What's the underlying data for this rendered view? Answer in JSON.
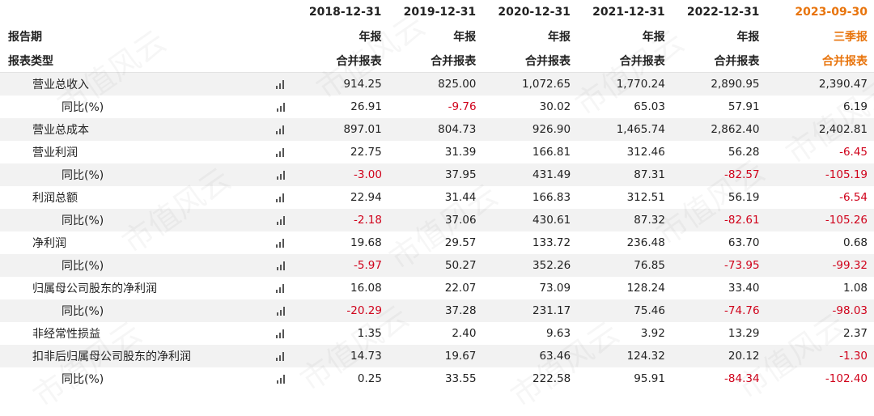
{
  "header": {
    "periods": [
      "2018-12-31",
      "2019-12-31",
      "2020-12-31",
      "2021-12-31",
      "2022-12-31",
      "2023-09-30"
    ],
    "report_period_label": "报告期",
    "report_types": [
      "年报",
      "年报",
      "年报",
      "年报",
      "年报",
      "三季报"
    ],
    "statement_type_label": "报表类型",
    "statement_types": [
      "合并报表",
      "合并报表",
      "合并报表",
      "合并报表",
      "合并报表",
      "合并报表"
    ]
  },
  "colors": {
    "negative": "#d0021b",
    "current_period": "#e8740c",
    "alt_row": "#f2f2f2"
  },
  "icons": {
    "chart": "bar-chart-icon"
  },
  "watermark": "市值风云",
  "rows": [
    {
      "label": "营业总收入",
      "level": 1,
      "values": [
        "914.25",
        "825.00",
        "1,072.65",
        "1,770.24",
        "2,890.95",
        "2,390.47"
      ]
    },
    {
      "label": "同比(%)",
      "level": 2,
      "values": [
        "26.91",
        "-9.76",
        "30.02",
        "65.03",
        "57.91",
        "6.19"
      ]
    },
    {
      "label": "营业总成本",
      "level": 1,
      "values": [
        "897.01",
        "804.73",
        "926.90",
        "1,465.74",
        "2,862.40",
        "2,402.81"
      ]
    },
    {
      "label": "营业利润",
      "level": 1,
      "values": [
        "22.75",
        "31.39",
        "166.81",
        "312.46",
        "56.28",
        "-6.45"
      ]
    },
    {
      "label": "同比(%)",
      "level": 2,
      "values": [
        "-3.00",
        "37.95",
        "431.49",
        "87.31",
        "-82.57",
        "-105.19"
      ]
    },
    {
      "label": "利润总额",
      "level": 1,
      "values": [
        "22.94",
        "31.44",
        "166.83",
        "312.51",
        "56.19",
        "-6.54"
      ]
    },
    {
      "label": "同比(%)",
      "level": 2,
      "values": [
        "-2.18",
        "37.06",
        "430.61",
        "87.32",
        "-82.61",
        "-105.26"
      ]
    },
    {
      "label": "净利润",
      "level": 1,
      "values": [
        "19.68",
        "29.57",
        "133.72",
        "236.48",
        "63.70",
        "0.68"
      ]
    },
    {
      "label": "同比(%)",
      "level": 2,
      "values": [
        "-5.97",
        "50.27",
        "352.26",
        "76.85",
        "-73.95",
        "-99.32"
      ]
    },
    {
      "label": "归属母公司股东的净利润",
      "level": 1,
      "values": [
        "16.08",
        "22.07",
        "73.09",
        "128.24",
        "33.40",
        "1.08"
      ]
    },
    {
      "label": "同比(%)",
      "level": 2,
      "values": [
        "-20.29",
        "37.28",
        "231.17",
        "75.46",
        "-74.76",
        "-98.03"
      ]
    },
    {
      "label": "非经常性损益",
      "level": 1,
      "values": [
        "1.35",
        "2.40",
        "9.63",
        "3.92",
        "13.29",
        "2.37"
      ]
    },
    {
      "label": "扣非后归属母公司股东的净利润",
      "level": 1,
      "values": [
        "14.73",
        "19.67",
        "63.46",
        "124.32",
        "20.12",
        "-1.30"
      ]
    },
    {
      "label": "同比(%)",
      "level": 2,
      "values": [
        "0.25",
        "33.55",
        "222.58",
        "95.91",
        "-84.34",
        "-102.40"
      ]
    }
  ]
}
